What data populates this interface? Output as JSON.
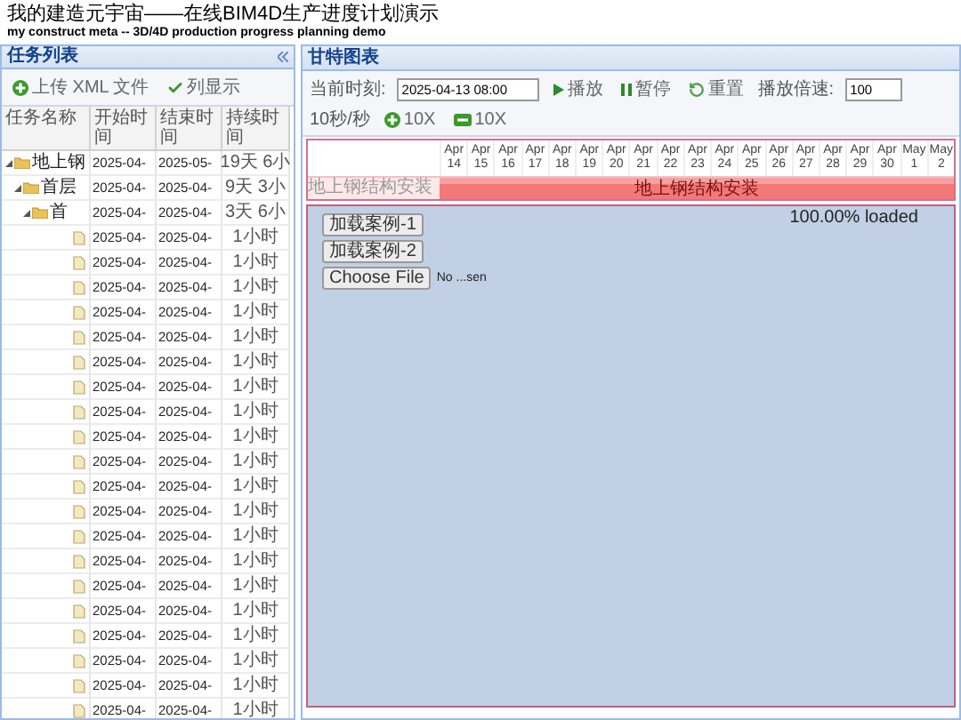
{
  "header": {
    "title": "我的建造元宇宙——在线BIM4D生产进度计划演示",
    "subtitle": "my construct meta -- 3D/4D production progress planning demo"
  },
  "task_panel": {
    "title": "任务列表",
    "toolbar": [
      {
        "label": "上传 XML 文件",
        "kind": "add"
      },
      {
        "label": "列显示",
        "kind": "check"
      }
    ],
    "columns": [
      "任务名称",
      "开始时间",
      "结束时间",
      "持续时间"
    ],
    "tasks": [
      {
        "kind": "folder",
        "name": "地上钢",
        "start": "2025-04-",
        "end": "2025-05-",
        "duration": "19天 6小",
        "expanded": true,
        "children": [
          {
            "kind": "folder",
            "name": "首层",
            "start": "2025-04-",
            "end": "2025-04-",
            "duration": "9天 3小",
            "expanded": true,
            "children": [
              {
                "kind": "folder",
                "name": "首",
                "start": "2025-04-",
                "end": "2025-04-",
                "duration": "3天 6小",
                "expanded": true,
                "children": [
                  {
                    "kind": "task",
                    "start": "2025-04-",
                    "end": "2025-04-",
                    "duration": "1小时"
                  },
                  {
                    "kind": "task",
                    "start": "2025-04-",
                    "end": "2025-04-",
                    "duration": "1小时"
                  },
                  {
                    "kind": "task",
                    "start": "2025-04-",
                    "end": "2025-04-",
                    "duration": "1小时"
                  },
                  {
                    "kind": "task",
                    "start": "2025-04-",
                    "end": "2025-04-",
                    "duration": "1小时"
                  },
                  {
                    "kind": "task",
                    "start": "2025-04-",
                    "end": "2025-04-",
                    "duration": "1小时"
                  },
                  {
                    "kind": "task",
                    "start": "2025-04-",
                    "end": "2025-04-",
                    "duration": "1小时"
                  },
                  {
                    "kind": "task",
                    "start": "2025-04-",
                    "end": "2025-04-",
                    "duration": "1小时"
                  },
                  {
                    "kind": "task",
                    "start": "2025-04-",
                    "end": "2025-04-",
                    "duration": "1小时"
                  },
                  {
                    "kind": "task",
                    "start": "2025-04-",
                    "end": "2025-04-",
                    "duration": "1小时"
                  },
                  {
                    "kind": "task",
                    "start": "2025-04-",
                    "end": "2025-04-",
                    "duration": "1小时"
                  },
                  {
                    "kind": "task",
                    "start": "2025-04-",
                    "end": "2025-04-",
                    "duration": "1小时"
                  },
                  {
                    "kind": "task",
                    "start": "2025-04-",
                    "end": "2025-04-",
                    "duration": "1小时"
                  },
                  {
                    "kind": "task",
                    "start": "2025-04-",
                    "end": "2025-04-",
                    "duration": "1小时"
                  },
                  {
                    "kind": "task",
                    "start": "2025-04-",
                    "end": "2025-04-",
                    "duration": "1小时"
                  },
                  {
                    "kind": "task",
                    "start": "2025-04-",
                    "end": "2025-04-",
                    "duration": "1小时"
                  },
                  {
                    "kind": "task",
                    "start": "2025-04-",
                    "end": "2025-04-",
                    "duration": "1小时"
                  },
                  {
                    "kind": "task",
                    "start": "2025-04-",
                    "end": "2025-04-",
                    "duration": "1小时"
                  },
                  {
                    "kind": "task",
                    "start": "2025-04-",
                    "end": "2025-04-",
                    "duration": "1小时"
                  },
                  {
                    "kind": "task",
                    "start": "2025-04-",
                    "end": "2025-04-",
                    "duration": "1小时"
                  },
                  {
                    "kind": "task",
                    "start": "2025-04-",
                    "end": "2025-04-",
                    "duration": "1小时"
                  }
                ]
              }
            ]
          }
        ]
      }
    ]
  },
  "gantt_panel": {
    "title": "甘特图表",
    "toolbar": {
      "time_label": "当前时刻:",
      "time_value": "2025-04-13 08:00",
      "buttons": [
        {
          "label": "播放",
          "kind": "play"
        },
        {
          "label": "暂停",
          "kind": "pause"
        },
        {
          "label": "重置",
          "kind": "reset"
        }
      ],
      "speed_label": "播放倍速:",
      "speed_value": "100",
      "speed_unit": "10秒/秒",
      "zoom": [
        {
          "label": "10X",
          "kind": "plus"
        },
        {
          "label": "10X",
          "kind": "minus"
        }
      ]
    },
    "timeline": {
      "dates": [
        "Apr 14",
        "Apr 15",
        "Apr 16",
        "Apr 17",
        "Apr 18",
        "Apr 19",
        "Apr 20",
        "Apr 21",
        "Apr 22",
        "Apr 23",
        "Apr 24",
        "Apr 25",
        "Apr 26",
        "Apr 27",
        "Apr 28",
        "Apr 29",
        "Apr 30",
        "May 1",
        "May 2"
      ],
      "rows": [
        {
          "label": "地上钢结构安装",
          "bar_label": "地上钢结构安装"
        }
      ]
    },
    "viewer": {
      "status": "100.00% loaded",
      "buttons": [
        "加载案例-1",
        "加载案例-2"
      ],
      "file_button": "Choose File",
      "file_status": "No ...sen"
    }
  }
}
